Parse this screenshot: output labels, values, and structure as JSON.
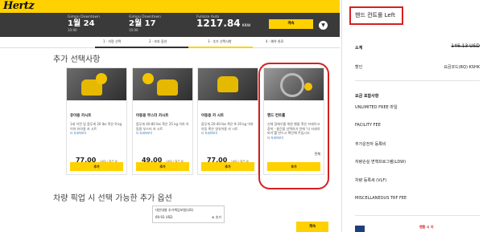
{
  "brand": {
    "logo": "Hertz",
    "accent": "#ffd100",
    "annotation_color": "#d42121"
  },
  "booking": {
    "pickup_caption": "Gimpo Downtown",
    "pickup_date": "1월 24",
    "pickup_time": "10:00",
    "return_caption": "Gimpo Downtown",
    "return_date": "2월 17",
    "return_time": "10:00",
    "car_caption": "Fullsize Auto",
    "total_price": "1217.84",
    "currency": "KRW",
    "continue_label": "계속"
  },
  "steps": [
    "1 · 차량 선택",
    "2 · 보호 옵션",
    "3 · 추가 선택사항",
    "4 · 예약 완료"
  ],
  "main": {
    "section_title": "추가 선택사항",
    "cards": [
      {
        "name": "유아용 카시트",
        "desc": "1세 이전 및 몸무게 20 lbs 혹은 9 kg 이하 유아용 카 시트",
        "more": "더 자세히보기",
        "price": "77.00",
        "unit": "USD / 일간 요",
        "add": "추가",
        "image": "infant-seat-photo"
      },
      {
        "name": "아동용 부스터 카시트",
        "desc": "몸무게 40-80 lbs 혹은 25 kg 이하 아동용 부스터 카 시트",
        "more": "더 자세히보기",
        "price": "49.00",
        "unit": "USD / 일간 요",
        "add": "추가",
        "image": "booster-seat-photo"
      },
      {
        "name": "아동용 카 시트",
        "desc": "몸무게 20-40 lbs 혹은 9-19 kg 이하 아동 혹은 영유아용 카 시트",
        "more": "더 자세히보기",
        "price": "77.00",
        "unit": "USD / 일간 요",
        "add": "추가",
        "image": "child-seat-photo"
      },
      {
        "name": "핸드 컨트롤",
        "desc": "신체 장애우를 위한 핸들 혹은 브레이크 장착 - 물건을 선택하기 전에 '더 자세히보기'를 반드시 확인해 주십시오",
        "more": "더 자세히보기",
        "qty": "전체",
        "add": "추가",
        "image": "hand-control-photo"
      }
    ],
    "pickup_title": "차량 픽업 시 선택 가능한 추가 옵션",
    "option": {
      "title": "대인대물 추가책임보험(LIS)",
      "price": "69.93 USD",
      "add": "추가"
    },
    "continue_label": "계속"
  },
  "panel": {
    "hand_title": "핸드 컨트롤 Left",
    "subtotal_label": "소계",
    "subtotal_value": "146.13 USD",
    "discount_label": "할인",
    "discount_value": "요금코드(RQ) KSHK",
    "included_label": "요금 포함사항",
    "included": [
      "UNLIMITED FREE 마일",
      "FACILITY FEE",
      "추가운전자 등록비",
      "자량손실 면책프로그램(LDW)",
      "차량 등록세 (VLF)",
      "MISCELLANEOUS TRF FEE"
    ],
    "bottom_text": "렌탈 시 지"
  }
}
